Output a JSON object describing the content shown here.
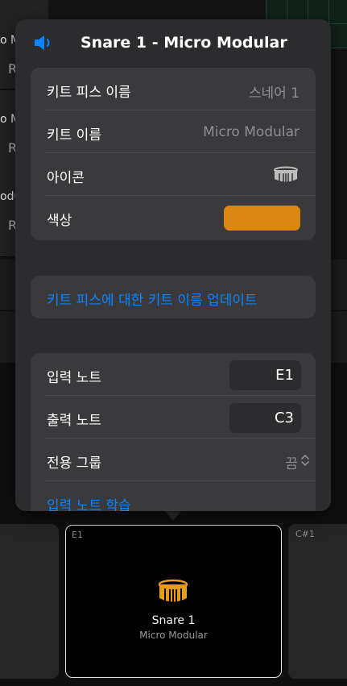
{
  "background": {
    "tracks": [
      {
        "name": "o M",
        "sub": "R"
      },
      {
        "name": "o M",
        "sub": "R"
      },
      {
        "name": "odu",
        "sub": "R"
      }
    ],
    "pads": {
      "left_note": "",
      "right_note": "C#1",
      "selected": {
        "note": "E1",
        "name": "Snare 1",
        "kit": "Micro Modular",
        "icon": "snare-drum-icon"
      }
    }
  },
  "popover": {
    "header": {
      "icon": "speaker-icon",
      "title": "Snare 1 - Micro Modular"
    },
    "info": {
      "kit_piece_name": {
        "label": "키트 피스 이름",
        "value": "스네어 1"
      },
      "kit_name": {
        "label": "키트 이름",
        "value": "Micro Modular"
      },
      "icon": {
        "label": "아이콘",
        "value": "snare-drum-icon"
      },
      "color": {
        "label": "색상",
        "value": "#d98712"
      }
    },
    "update_button": {
      "label": "키트 피스에 대한 키트 이름 업데이트"
    },
    "notes": {
      "input_note": {
        "label": "입력 노트",
        "value": "E1"
      },
      "output_note": {
        "label": "출력 노트",
        "value": "C3"
      },
      "choke_group": {
        "label": "전용 그룹",
        "value": "끔"
      },
      "learn_input": {
        "label": "입력 노트 학습"
      }
    }
  },
  "colors": {
    "accent": "#0a84ff",
    "kit_color": "#d98712"
  }
}
